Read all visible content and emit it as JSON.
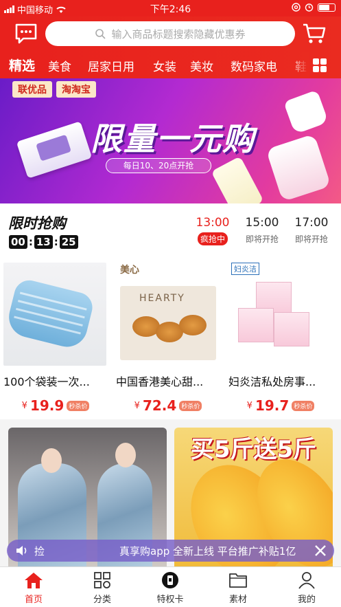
{
  "status_bar": {
    "carrier": "中国移动",
    "time": "下午2:46"
  },
  "header": {
    "search_placeholder": "输入商品标题搜索隐藏优惠券"
  },
  "categories": {
    "active": "精选",
    "items": [
      "美食",
      "居家日用",
      "女装",
      "美妆",
      "数码家电"
    ],
    "overflow": "鞋"
  },
  "banner": {
    "logos": [
      "联优品",
      "淘淘宝"
    ],
    "title": "限量一元购",
    "subtitle": "每日10、20点开抢"
  },
  "flash_sale": {
    "title": "限时抢购",
    "countdown": [
      "00",
      "13",
      "25"
    ],
    "slots": [
      {
        "time": "13:00",
        "status": "疯抢中",
        "active": true
      },
      {
        "time": "15:00",
        "status": "即将开抢",
        "active": false
      },
      {
        "time": "17:00",
        "status": "即将开抢",
        "active": false
      }
    ],
    "products": [
      {
        "name": "100个袋装一次...",
        "yen": "¥",
        "price": "19.9",
        "tag": "秒杀价"
      },
      {
        "name": "中国香港美心甜...",
        "yen": "¥",
        "price": "72.4",
        "tag": "秒杀价",
        "brand": "美心"
      },
      {
        "name": "妇炎洁私处房事...",
        "yen": "¥",
        "price": "19.7",
        "tag": "秒杀价",
        "brand": "妇炎洁"
      }
    ]
  },
  "feed": {
    "mango_title": "买5斤送5斤"
  },
  "notice": {
    "label": "捡",
    "text": "真享购app 全新上线 平台推广补贴1亿"
  },
  "tabbar": [
    {
      "label": "首页",
      "icon": "home-icon",
      "active": true
    },
    {
      "label": "分类",
      "icon": "category-grid-icon",
      "active": false
    },
    {
      "label": "特权卡",
      "icon": "privilege-card-icon",
      "active": false
    },
    {
      "label": "素材",
      "icon": "folder-icon",
      "active": false
    },
    {
      "label": "我的",
      "icon": "user-icon",
      "active": false
    }
  ],
  "colors": {
    "brand_red": "#e8211d",
    "price_red": "#e8211d",
    "notice_purple": "#785fc8"
  }
}
